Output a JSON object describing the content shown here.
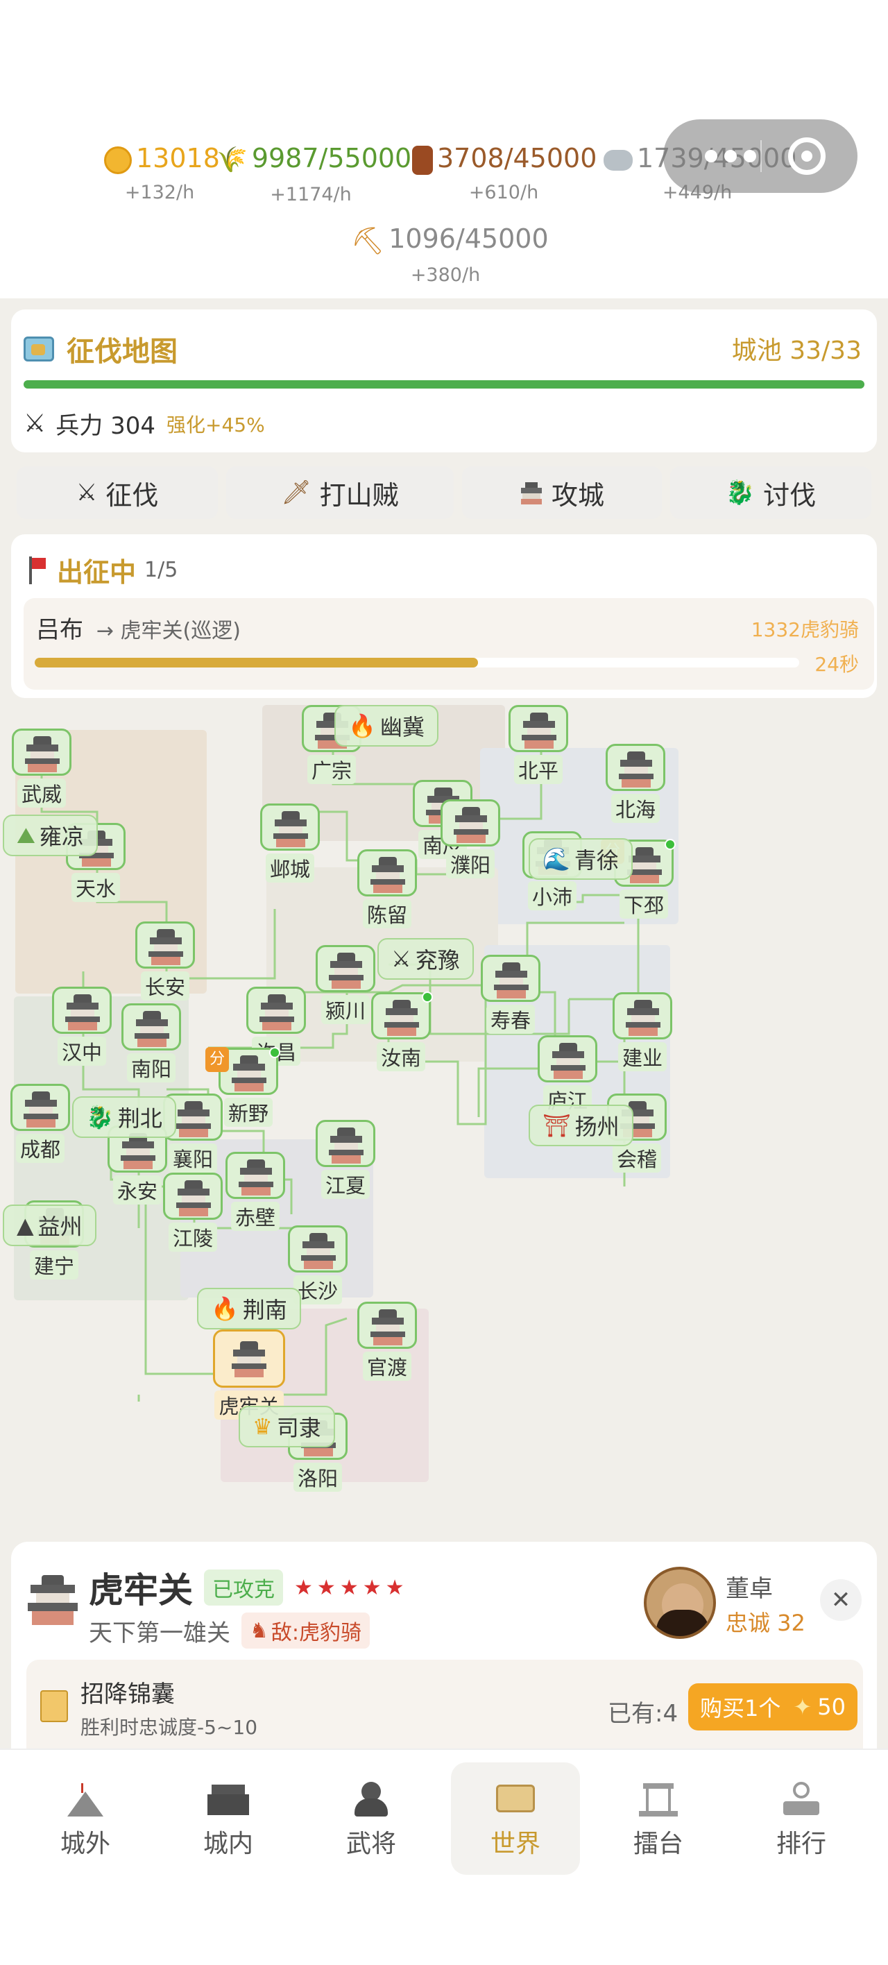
{
  "resources": {
    "gold": {
      "value": "13018",
      "rate": "+132/h",
      "color": "#e8a51c"
    },
    "grain": {
      "value": "9987/55000",
      "rate": "+1174/h",
      "color": "#5a9a30"
    },
    "wood": {
      "value": "3708/45000",
      "rate": "+610/h",
      "color": "#9a5a2a"
    },
    "stone": {
      "value": "1739/45000",
      "rate": "+449/h",
      "color": "#8a8a8a"
    },
    "iron": {
      "value": "1096/45000",
      "rate": "+380/h",
      "color": "#8a8a8a"
    }
  },
  "conquest": {
    "title": "征伐地图",
    "cities_label": "城池 33/33",
    "progress": 1.0,
    "troops_label": "兵力 304",
    "boost": "强化+45%"
  },
  "tabs": [
    {
      "label": "征伐",
      "icon": "crossed-swords-icon"
    },
    {
      "label": "打山贼",
      "icon": "dagger-icon"
    },
    {
      "label": "攻城",
      "icon": "castle-icon"
    },
    {
      "label": "讨伐",
      "icon": "dragon-icon"
    }
  ],
  "expedition": {
    "title": "出征中",
    "count": "1/5",
    "general": "吕布",
    "target": "→ 虎牢关(巡逻)",
    "enemy": "1332虎豹骑",
    "progress": 0.58,
    "time": "24秒"
  },
  "regions": [
    "幽冀",
    "雍凉",
    "青徐",
    "兖豫",
    "荆北",
    "扬州",
    "益州",
    "荆南",
    "司隶"
  ],
  "cities": [
    "广宗",
    "北平",
    "武威",
    "北海",
    "南皮",
    "濮阳",
    "邺城",
    "天水",
    "小沛",
    "下邳",
    "陈留",
    "长安",
    "颍川",
    "寿春",
    "汉中",
    "许昌",
    "汝南",
    "建业",
    "南阳",
    "庐江",
    "新野",
    "成都",
    "襄阳",
    "会稽",
    "江夏",
    "永安",
    "赤壁",
    "江陵",
    "建宁",
    "长沙",
    "官渡",
    "虎牢关",
    "洛阳"
  ],
  "fen_badge": "分",
  "selected_city": {
    "name": "虎牢关",
    "status": "已攻克",
    "stars": 5,
    "subtitle": "天下第一雄关",
    "enemy": "敌:虎豹骑",
    "defender_name": "董卓",
    "loyalty": "忠诚 32"
  },
  "item": {
    "name": "招降锦囊",
    "desc": "胜利时忠诚度-5~10",
    "owned": "已有:4",
    "buy_label": "购买1个",
    "price": "50"
  },
  "nav": [
    {
      "label": "城外",
      "icon": "tent-icon"
    },
    {
      "label": "城内",
      "icon": "fortress-icon"
    },
    {
      "label": "武将",
      "icon": "general-icon"
    },
    {
      "label": "世界",
      "icon": "map-scroll-icon"
    },
    {
      "label": "擂台",
      "icon": "arena-icon"
    },
    {
      "label": "排行",
      "icon": "ranking-icon"
    }
  ]
}
